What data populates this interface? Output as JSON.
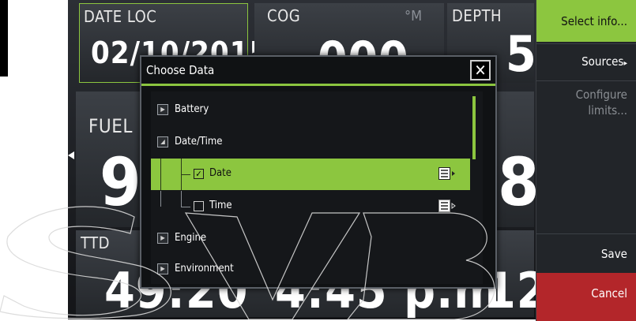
{
  "tiles": {
    "date_loc": {
      "label": "DATE LOC",
      "value": "02/10/2015"
    },
    "cog": {
      "label": "COG",
      "value": "000",
      "unit": "°M"
    },
    "depth": {
      "label": "DEPTH",
      "value": "5"
    },
    "fuel": {
      "label": "FUEL",
      "value": "9"
    },
    "right_mid": {
      "value": "8"
    },
    "ttd": {
      "label": "TTD",
      "value": "49:20"
    },
    "bottom_mid": {
      "value": "4:45 p.m"
    },
    "bottom_right": {
      "value": "12"
    }
  },
  "menu": {
    "select_info": "Select info...",
    "sources": "Sources",
    "configure_line1": "Configure",
    "configure_line2": "limits...",
    "save": "Save",
    "cancel": "Cancel"
  },
  "dialog": {
    "title": "Choose Data",
    "close": "✕",
    "items": [
      {
        "label": "Battery"
      },
      {
        "label": "Date/Time"
      },
      {
        "label": "Date"
      },
      {
        "label": "Time"
      },
      {
        "label": "Engine"
      },
      {
        "label": "Environment"
      }
    ]
  },
  "colors": {
    "accent": "#8cc63f",
    "cancel": "#b3262a"
  }
}
